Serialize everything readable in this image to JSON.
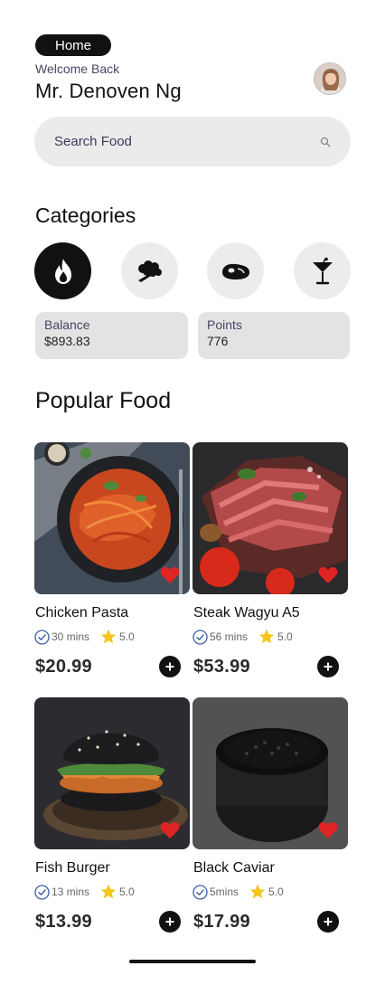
{
  "header": {
    "home_label": "Home",
    "welcome": "Welcome Back",
    "user_name": "Mr. Denoven Ng"
  },
  "search": {
    "placeholder": "Search Food"
  },
  "categories": {
    "title": "Categories",
    "items": [
      {
        "icon": "fire-icon",
        "active": true
      },
      {
        "icon": "broccoli-icon",
        "active": false
      },
      {
        "icon": "steak-icon",
        "active": false
      },
      {
        "icon": "cocktail-icon",
        "active": false
      }
    ]
  },
  "stats": {
    "balance": {
      "label": "Balance",
      "value": "$893.83"
    },
    "points": {
      "label": "Points",
      "value": "776"
    }
  },
  "popular": {
    "title": "Popular Food",
    "items": [
      {
        "name": "Chicken Pasta",
        "time": "30 mins",
        "rating": "5.0",
        "price": "$20.99",
        "favorite": true
      },
      {
        "name": "Steak Wagyu A5",
        "time": "56 mins",
        "rating": "5.0",
        "price": "$53.99",
        "favorite": true
      },
      {
        "name": "Fish Burger",
        "time": "13 mins",
        "rating": "5.0",
        "price": "$13.99",
        "favorite": true
      },
      {
        "name": "Black Caviar",
        "time": "5mins",
        "rating": "5.0",
        "price": "$17.99",
        "favorite": true
      }
    ]
  },
  "colors": {
    "accent": "#111111",
    "heart": "#e02424",
    "star": "#f5c518",
    "clock": "#3a5fa8"
  }
}
